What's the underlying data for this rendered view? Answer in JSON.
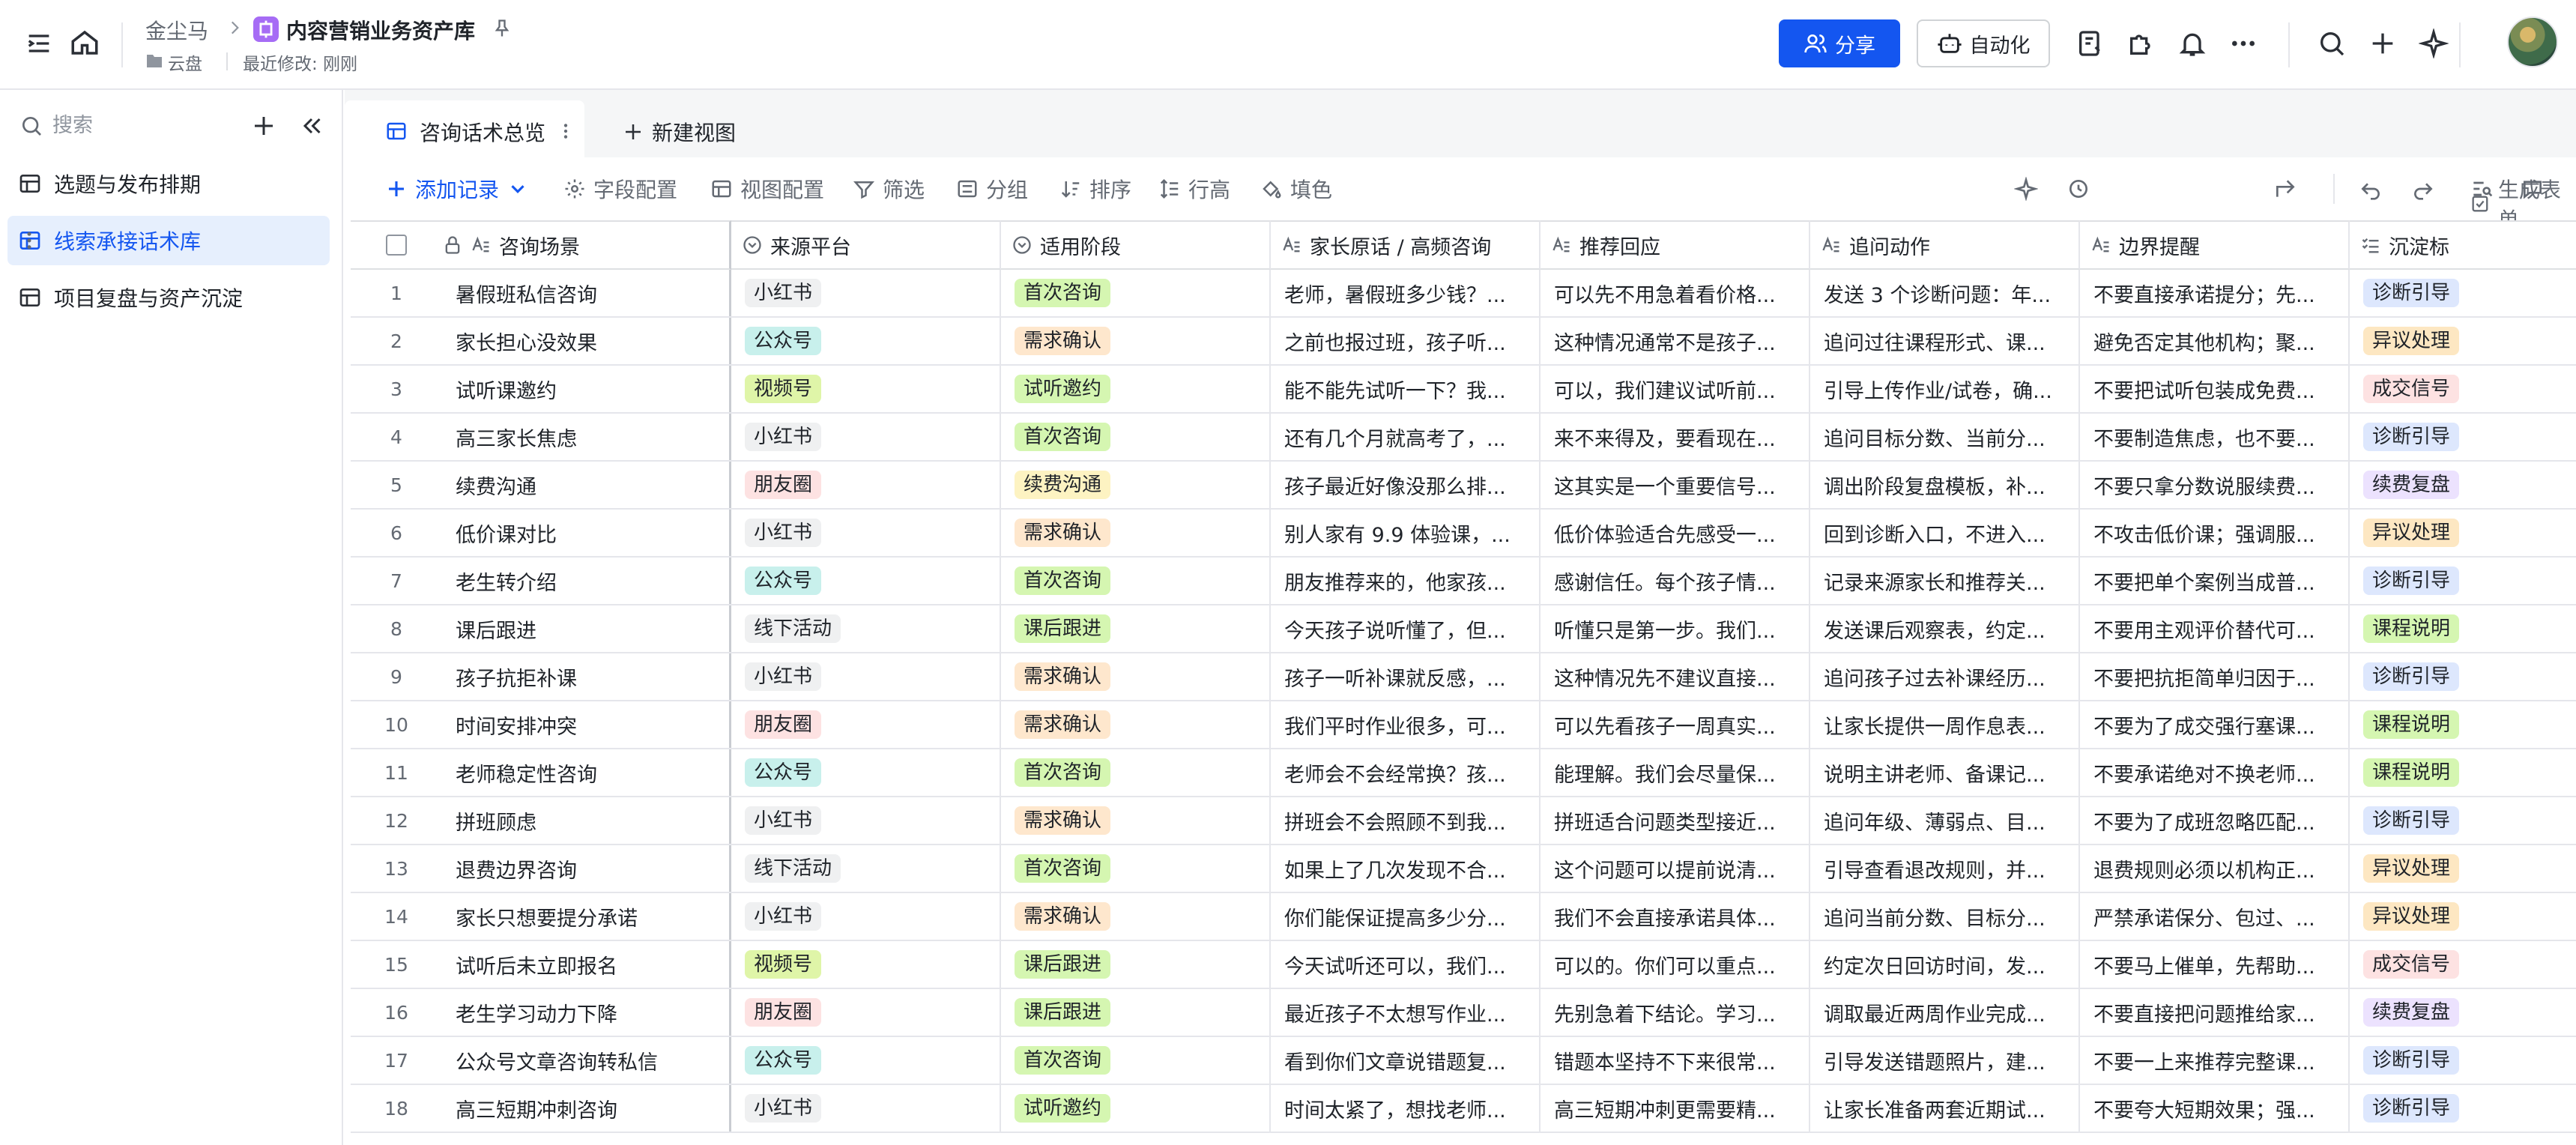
{
  "header": {
    "breadcrumb_root": "金尘马",
    "app_name": "内容营销业务资产库",
    "location": "云盘",
    "last_modified": "最近修改: 刚刚",
    "share_label": "分享",
    "automation_label": "自动化"
  },
  "sidebar": {
    "search_placeholder": "搜索",
    "items": [
      {
        "label": "选题与发布排期"
      },
      {
        "label": "线索承接话术库"
      },
      {
        "label": "项目复盘与资产沉淀"
      }
    ]
  },
  "view_tabs": {
    "active_label": "咨询话术总览",
    "new_view_label": "新建视图"
  },
  "toolbar": {
    "add_record": "添加记录",
    "field_config": "字段配置",
    "view_config": "视图配置",
    "filter": "筛选",
    "group": "分组",
    "sort": "排序",
    "row_height": "行高",
    "fill": "填色",
    "generate_form": "生成表单"
  },
  "table": {
    "columns": [
      "咨询场景",
      "来源平台",
      "适用阶段",
      "家长原话 / 高频咨询",
      "推荐回应",
      "追问动作",
      "边界提醒",
      "沉淀标"
    ],
    "colors": {
      "小红书": "#eff0f1",
      "公众号": "#c8f0ec",
      "视频号": "#dff5a8",
      "朋友圈": "#fde2e2",
      "线下活动": "#eff0f1",
      "首次咨询": "#d5f6b1",
      "需求确认": "#fee7cd",
      "试听邀约": "#d5f6b1",
      "续费沟通": "#fdf3c2",
      "课后跟进": "#d5f6b1",
      "诊断引导": "#dde7fd",
      "异议处理": "#fde7c2",
      "成交信号": "#fde2e2",
      "续费复盘": "#ece2fe",
      "课程说明": "#d5f6b1"
    },
    "rows": [
      {
        "num": "1",
        "scene": "暑假班私信咨询",
        "platform": "小红书",
        "stage": "首次咨询",
        "quote": "老师，暑假班多少钱？...",
        "reply": "可以先不用急着看价格...",
        "action": "发送 3 个诊断问题：年...",
        "boundary": "不要直接承诺提分；先...",
        "tag": "诊断引导"
      },
      {
        "num": "2",
        "scene": "家长担心没效果",
        "platform": "公众号",
        "stage": "需求确认",
        "quote": "之前也报过班，孩子听...",
        "reply": "这种情况通常不是孩子...",
        "action": "追问过往课程形式、课...",
        "boundary": "避免否定其他机构；聚...",
        "tag": "异议处理"
      },
      {
        "num": "3",
        "scene": "试听课邀约",
        "platform": "视频号",
        "stage": "试听邀约",
        "quote": "能不能先试听一下？我...",
        "reply": "可以，我们建议试听前...",
        "action": "引导上传作业/试卷，确...",
        "boundary": "不要把试听包装成免费...",
        "tag": "成交信号"
      },
      {
        "num": "4",
        "scene": "高三家长焦虑",
        "platform": "小红书",
        "stage": "首次咨询",
        "quote": "还有几个月就高考了，...",
        "reply": "来不来得及，要看现在...",
        "action": "追问目标分数、当前分...",
        "boundary": "不要制造焦虑，也不要...",
        "tag": "诊断引导"
      },
      {
        "num": "5",
        "scene": "续费沟通",
        "platform": "朋友圈",
        "stage": "续费沟通",
        "quote": "孩子最近好像没那么排...",
        "reply": "这其实是一个重要信号...",
        "action": "调出阶段复盘模板，补...",
        "boundary": "不要只拿分数说服续费...",
        "tag": "续费复盘"
      },
      {
        "num": "6",
        "scene": "低价课对比",
        "platform": "小红书",
        "stage": "需求确认",
        "quote": "别人家有 9.9 体验课，...",
        "reply": "低价体验适合先感受一...",
        "action": "回到诊断入口，不进入...",
        "boundary": "不攻击低价课；强调服...",
        "tag": "异议处理"
      },
      {
        "num": "7",
        "scene": "老生转介绍",
        "platform": "公众号",
        "stage": "首次咨询",
        "quote": "朋友推荐来的，他家孩...",
        "reply": "感谢信任。每个孩子情...",
        "action": "记录来源家长和推荐关...",
        "boundary": "不要把单个案例当成普...",
        "tag": "诊断引导"
      },
      {
        "num": "8",
        "scene": "课后跟进",
        "platform": "线下活动",
        "stage": "课后跟进",
        "quote": "今天孩子说听懂了，但...",
        "reply": "听懂只是第一步。我们...",
        "action": "发送课后观察表，约定...",
        "boundary": "不要用主观评价替代可...",
        "tag": "课程说明"
      },
      {
        "num": "9",
        "scene": "孩子抗拒补课",
        "platform": "小红书",
        "stage": "需求确认",
        "quote": "孩子一听补课就反感，...",
        "reply": "这种情况先不建议直接...",
        "action": "追问孩子过去补课经历...",
        "boundary": "不要把抗拒简单归因于...",
        "tag": "诊断引导"
      },
      {
        "num": "10",
        "scene": "时间安排冲突",
        "platform": "朋友圈",
        "stage": "需求确认",
        "quote": "我们平时作业很多，可...",
        "reply": "可以先看孩子一周真实...",
        "action": "让家长提供一周作息表...",
        "boundary": "不要为了成交强行塞课...",
        "tag": "课程说明"
      },
      {
        "num": "11",
        "scene": "老师稳定性咨询",
        "platform": "公众号",
        "stage": "首次咨询",
        "quote": "老师会不会经常换？孩...",
        "reply": "能理解。我们会尽量保...",
        "action": "说明主讲老师、备课记...",
        "boundary": "不要承诺绝对不换老师...",
        "tag": "课程说明"
      },
      {
        "num": "12",
        "scene": "拼班顾虑",
        "platform": "小红书",
        "stage": "需求确认",
        "quote": "拼班会不会照顾不到我...",
        "reply": "拼班适合问题类型接近...",
        "action": "追问年级、薄弱点、目...",
        "boundary": "不要为了成班忽略匹配...",
        "tag": "诊断引导"
      },
      {
        "num": "13",
        "scene": "退费边界咨询",
        "platform": "线下活动",
        "stage": "首次咨询",
        "quote": "如果上了几次发现不合...",
        "reply": "这个问题可以提前说清...",
        "action": "引导查看退改规则，并...",
        "boundary": "退费规则必须以机构正...",
        "tag": "异议处理"
      },
      {
        "num": "14",
        "scene": "家长只想要提分承诺",
        "platform": "小红书",
        "stage": "需求确认",
        "quote": "你们能保证提高多少分...",
        "reply": "我们不会直接承诺具体...",
        "action": "追问当前分数、目标分...",
        "boundary": "严禁承诺保分、包过、...",
        "tag": "异议处理"
      },
      {
        "num": "15",
        "scene": "试听后未立即报名",
        "platform": "视频号",
        "stage": "课后跟进",
        "quote": "今天试听还可以，我们...",
        "reply": "可以的。你们可以重点...",
        "action": "约定次日回访时间，发...",
        "boundary": "不要马上催单，先帮助...",
        "tag": "成交信号"
      },
      {
        "num": "16",
        "scene": "老生学习动力下降",
        "platform": "朋友圈",
        "stage": "课后跟进",
        "quote": "最近孩子不太想写作业...",
        "reply": "先别急着下结论。学习...",
        "action": "调取最近两周作业完成...",
        "boundary": "不要直接把问题推给家...",
        "tag": "续费复盘"
      },
      {
        "num": "17",
        "scene": "公众号文章咨询转私信",
        "platform": "公众号",
        "stage": "首次咨询",
        "quote": "看到你们文章说错题复...",
        "reply": "错题本坚持不下来很常...",
        "action": "引导发送错题照片，建...",
        "boundary": "不要一上来推荐完整课...",
        "tag": "诊断引导"
      },
      {
        "num": "18",
        "scene": "高三短期冲刺咨询",
        "platform": "小红书",
        "stage": "试听邀约",
        "quote": "时间太紧了，想找老师...",
        "reply": "高三短期冲刺更需要精...",
        "action": "让家长准备两套近期试...",
        "boundary": "不要夸大短期效果；强...",
        "tag": "诊断引导"
      }
    ]
  },
  "accent": "#1456f0"
}
